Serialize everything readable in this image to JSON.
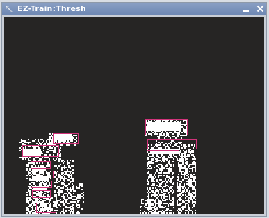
{
  "window": {
    "title": "EZ-Train:Thresh",
    "controls": [
      "minimize-icon",
      "close-icon"
    ]
  },
  "canvas": {
    "background_color": "#262524",
    "foreground_color": "#ffffff",
    "box_color": "#d0337a"
  }
}
